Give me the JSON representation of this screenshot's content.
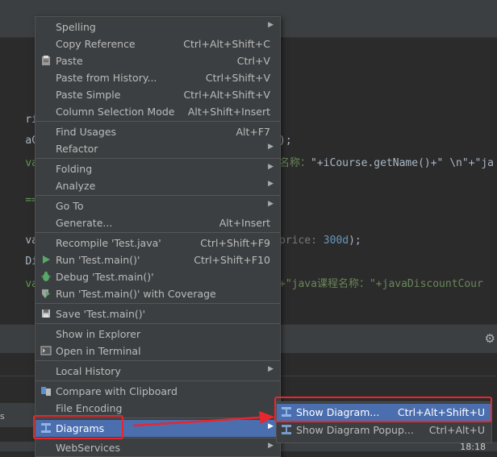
{
  "editor": {
    "lines": [
      {
        "text": "ring[] "
      },
      {
        "text": "aCours"
      },
      {
        "text": "va课程",
        "tail_hint": "名称：",
        "tail_code": "\"+iCourse.getName()+\" \\n\"+\"ja"
      },
      {
        "text": "======"
      },
      {
        "text": "vaDisc",
        "tail_hint": "price:",
        "tail_num": "300d",
        "tail_code": ");"
      },
      {
        "text": "Discou"
      },
      {
        "text": "va课程",
        "tail_code": "+\"java课程名称：\"+javaDiscountCour"
      }
    ],
    "code_close": ");"
  },
  "tool_window": {
    "left_label": "s"
  },
  "status": {
    "time": "18:18"
  },
  "context_menu": {
    "items": [
      {
        "label": "Spelling",
        "shortcut": "",
        "submenu": true,
        "icon": ""
      },
      {
        "label": "Copy Reference",
        "shortcut": "Ctrl+Alt+Shift+C",
        "submenu": false,
        "icon": ""
      },
      {
        "label": "Paste",
        "shortcut": "Ctrl+V",
        "submenu": false,
        "icon": "clipboard-icon"
      },
      {
        "label": "Paste from History...",
        "shortcut": "Ctrl+Shift+V",
        "submenu": false,
        "icon": ""
      },
      {
        "label": "Paste Simple",
        "shortcut": "Ctrl+Alt+Shift+V",
        "submenu": false,
        "icon": ""
      },
      {
        "label": "Column Selection Mode",
        "shortcut": "Alt+Shift+Insert",
        "submenu": false,
        "icon": ""
      },
      {
        "label": "Find Usages",
        "shortcut": "Alt+F7",
        "submenu": false,
        "icon": ""
      },
      {
        "label": "Refactor",
        "shortcut": "",
        "submenu": true,
        "icon": ""
      },
      {
        "label": "Folding",
        "shortcut": "",
        "submenu": true,
        "icon": ""
      },
      {
        "label": "Analyze",
        "shortcut": "",
        "submenu": true,
        "icon": ""
      },
      {
        "label": "Go To",
        "shortcut": "",
        "submenu": true,
        "icon": ""
      },
      {
        "label": "Generate...",
        "shortcut": "Alt+Insert",
        "submenu": false,
        "icon": ""
      },
      {
        "label": "Recompile 'Test.java'",
        "shortcut": "Ctrl+Shift+F9",
        "submenu": false,
        "icon": ""
      },
      {
        "label": "Run 'Test.main()'",
        "shortcut": "Ctrl+Shift+F10",
        "submenu": false,
        "icon": "run-icon"
      },
      {
        "label": "Debug 'Test.main()'",
        "shortcut": "",
        "submenu": false,
        "icon": "debug-icon"
      },
      {
        "label": "Run 'Test.main()' with Coverage",
        "shortcut": "",
        "submenu": false,
        "icon": "coverage-icon"
      },
      {
        "label": "Save 'Test.main()'",
        "shortcut": "",
        "submenu": false,
        "icon": "save-config-icon"
      },
      {
        "label": "Show in Explorer",
        "shortcut": "",
        "submenu": false,
        "icon": ""
      },
      {
        "label": "Open in Terminal",
        "shortcut": "",
        "submenu": false,
        "icon": "terminal-icon"
      },
      {
        "label": "Local History",
        "shortcut": "",
        "submenu": true,
        "icon": ""
      },
      {
        "label": "Compare with Clipboard",
        "shortcut": "",
        "submenu": false,
        "icon": "compare-icon"
      },
      {
        "label": "File Encoding",
        "shortcut": "",
        "submenu": false,
        "icon": ""
      },
      {
        "label": "Diagrams",
        "shortcut": "",
        "submenu": true,
        "icon": "diagram-icon"
      },
      {
        "label": "WebServices",
        "shortcut": "",
        "submenu": true,
        "icon": ""
      }
    ]
  },
  "diagrams_submenu": {
    "items": [
      {
        "label": "Show Diagram...",
        "shortcut": "Ctrl+Alt+Shift+U",
        "icon": "diagram-icon"
      },
      {
        "label": "Show Diagram Popup...",
        "shortcut": "Ctrl+Alt+U",
        "icon": "diagram-icon"
      }
    ]
  },
  "colors": {
    "menu_bg": "#3c3f41",
    "selection": "#4b6eaf",
    "annotation": "#e8262d",
    "editor_bg": "#2b2b2b"
  }
}
